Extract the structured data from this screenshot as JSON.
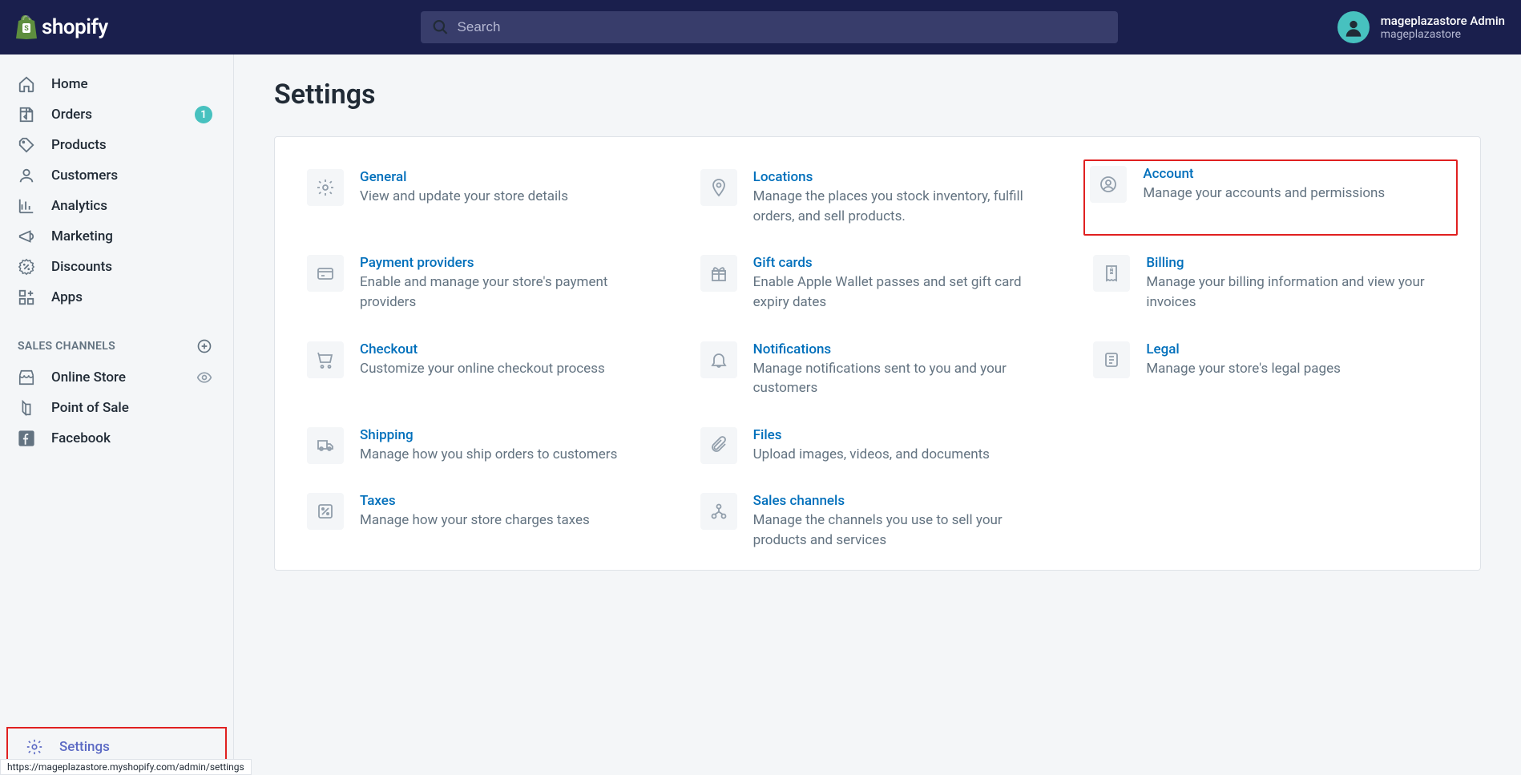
{
  "header": {
    "brand": "shopify",
    "search_placeholder": "Search",
    "user_name": "mageplazastore Admin",
    "user_store": "mageplazastore"
  },
  "sidebar": {
    "items": [
      {
        "label": "Home",
        "icon": "home"
      },
      {
        "label": "Orders",
        "icon": "orders",
        "badge": "1"
      },
      {
        "label": "Products",
        "icon": "products"
      },
      {
        "label": "Customers",
        "icon": "customers"
      },
      {
        "label": "Analytics",
        "icon": "analytics"
      },
      {
        "label": "Marketing",
        "icon": "marketing"
      },
      {
        "label": "Discounts",
        "icon": "discounts"
      },
      {
        "label": "Apps",
        "icon": "apps"
      }
    ],
    "section_header": "SALES CHANNELS",
    "channels": [
      {
        "label": "Online Store",
        "icon": "store",
        "eye": true
      },
      {
        "label": "Point of Sale",
        "icon": "pos"
      },
      {
        "label": "Facebook",
        "icon": "facebook"
      }
    ],
    "settings_label": "Settings"
  },
  "main": {
    "title": "Settings",
    "tiles": [
      {
        "title": "General",
        "desc": "View and update your store details",
        "icon": "gear"
      },
      {
        "title": "Locations",
        "desc": "Manage the places you stock inventory, fulfill orders, and sell products.",
        "icon": "pin"
      },
      {
        "title": "Account",
        "desc": "Manage your accounts and permissions",
        "icon": "user-circle",
        "highlight": true
      },
      {
        "title": "Payment providers",
        "desc": "Enable and manage your store's payment providers",
        "icon": "card"
      },
      {
        "title": "Gift cards",
        "desc": "Enable Apple Wallet passes and set gift card expiry dates",
        "icon": "gift"
      },
      {
        "title": "Billing",
        "desc": "Manage your billing information and view your invoices",
        "icon": "receipt"
      },
      {
        "title": "Checkout",
        "desc": "Customize your online checkout process",
        "icon": "cart"
      },
      {
        "title": "Notifications",
        "desc": "Manage notifications sent to you and your customers",
        "icon": "bell"
      },
      {
        "title": "Legal",
        "desc": "Manage your store's legal pages",
        "icon": "scroll"
      },
      {
        "title": "Shipping",
        "desc": "Manage how you ship orders to customers",
        "icon": "truck"
      },
      {
        "title": "Files",
        "desc": "Upload images, videos, and documents",
        "icon": "clip"
      },
      {
        "title": "",
        "desc": "",
        "icon": ""
      },
      {
        "title": "Taxes",
        "desc": "Manage how your store charges taxes",
        "icon": "percent"
      },
      {
        "title": "Sales channels",
        "desc": "Manage the channels you use to sell your products and services",
        "icon": "network"
      },
      {
        "title": "",
        "desc": "",
        "icon": ""
      }
    ]
  },
  "statusbar": "https://mageplazastore.myshopify.com/admin/settings"
}
